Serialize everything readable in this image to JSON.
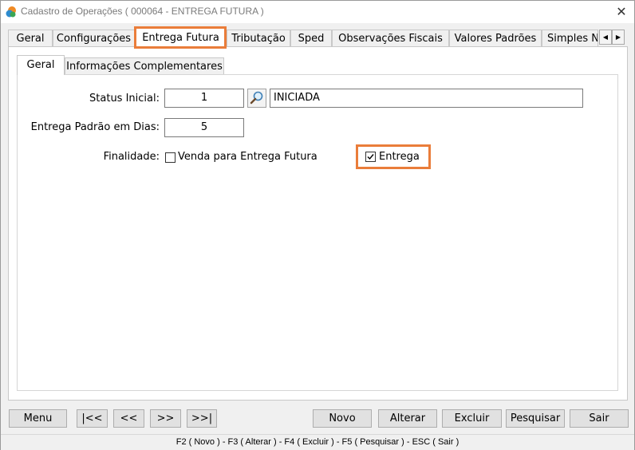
{
  "window": {
    "title": "Cadastro de Operações ( 000064 - ENTREGA FUTURA )",
    "close_glyph": "✕"
  },
  "tabs": [
    {
      "label": "Geral"
    },
    {
      "label": "Configurações"
    },
    {
      "label": "Entrega Futura",
      "active": true
    },
    {
      "label": "Tributação"
    },
    {
      "label": "Sped"
    },
    {
      "label": "Observações Fiscais"
    },
    {
      "label": "Valores Padrões"
    },
    {
      "label": "Simples N"
    }
  ],
  "tab_scroll": {
    "left": "◀",
    "right": "▶"
  },
  "subtabs": [
    {
      "label": "Geral",
      "active": true
    },
    {
      "label": "Informações Complementares"
    }
  ],
  "form": {
    "status_inicial": {
      "label": "Status Inicial:",
      "code": "1",
      "description": "INICIADA"
    },
    "entrega_padrao": {
      "label": "Entrega Padrão em Dias:",
      "value": "5"
    },
    "finalidade": {
      "label": "Finalidade:",
      "options": [
        {
          "label": "Venda para Entrega Futura",
          "checked": false
        },
        {
          "label": "Entrega",
          "checked": true
        }
      ]
    }
  },
  "toolbar": {
    "menu": "Menu",
    "first": "|<<",
    "prev": "<<",
    "next": ">>",
    "last": ">>|",
    "novo": "Novo",
    "alterar": "Alterar",
    "excluir": "Excluir",
    "pesquisar": "Pesquisar",
    "sair": "Sair"
  },
  "status_bar": "F2 ( Novo )  -  F3 ( Alterar )  -  F4 ( Excluir )  -  F5 ( Pesquisar )  -  ESC ( Sair )",
  "colors": {
    "highlight": "#ea7d3a"
  }
}
